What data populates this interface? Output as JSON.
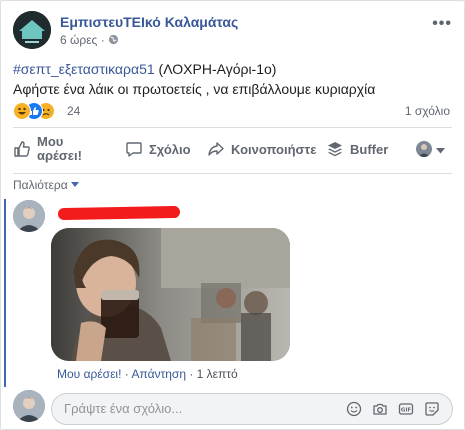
{
  "post": {
    "page_name": "ΕμπιστευΤΕΙκό Καλαμάτας",
    "time": "6 ώρες",
    "hashtag": "#σεπτ_εξεταστικαρα51",
    "line1_rest": " (ΛΟΧΡΗ-Αγόρι-1ο)",
    "line2": "Αφήστε ένα λάικ οι πρωτοετείς , να επιβάλλουμε κυριαρχία",
    "reactions": [
      "haha",
      "like",
      "sad"
    ],
    "reaction_count": "24",
    "comment_count": "1 σχόλιο"
  },
  "actions": {
    "like_line1": "Μου",
    "like_line2": "αρέσει!",
    "comment": "Σχόλιο",
    "share": "Κοινοποιήστε",
    "buffer": "Buffer"
  },
  "comments": {
    "sort_label": "Παλιότερα",
    "items": [
      {
        "like": "Μου αρέσει!",
        "reply": "Απάντηση",
        "time": "1 λεπτό",
        "sep": " · "
      }
    ],
    "composer_placeholder": "Γράψτε ένα σχόλιο..."
  },
  "colors": {
    "link": "#385898",
    "accent": "#4267b2",
    "redaction": "#f31b1b"
  }
}
